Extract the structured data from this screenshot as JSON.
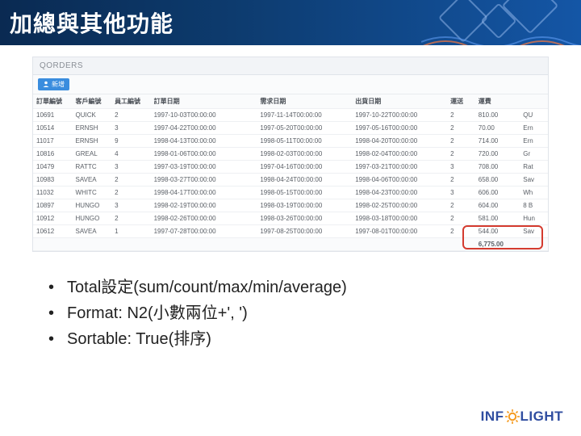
{
  "header": {
    "title": "加總與其他功能"
  },
  "panel": {
    "title": "QORDERS",
    "button_label": "新增"
  },
  "columns": [
    "訂單編號",
    "客戶編號",
    "員工編號",
    "訂單日期",
    "",
    "需求日期",
    "出貨日期",
    "運送",
    "運費",
    ""
  ],
  "rows": [
    {
      "c0": "10691",
      "c1": "QUICK",
      "c2": "2",
      "c3": "1997-10-03T00:00:00",
      "c4": "",
      "c5": "1997-11-14T00:00:00",
      "c6": "1997-10-22T00:00:00",
      "c7": "2",
      "c8": "810.00",
      "c9": "QU"
    },
    {
      "c0": "10514",
      "c1": "ERNSH",
      "c2": "3",
      "c3": "1997-04-22T00:00:00",
      "c4": "",
      "c5": "1997-05-20T00:00:00",
      "c6": "1997-05-16T00:00:00",
      "c7": "2",
      "c8": "70.00",
      "c9": "Ern"
    },
    {
      "c0": "11017",
      "c1": "ERNSH",
      "c2": "9",
      "c3": "1998-04-13T00:00:00",
      "c4": "",
      "c5": "1998-05-11T00:00:00",
      "c6": "1998-04-20T00:00:00",
      "c7": "2",
      "c8": "714.00",
      "c9": "Ern"
    },
    {
      "c0": "10816",
      "c1": "GREAL",
      "c2": "4",
      "c3": "1998-01-06T00:00:00",
      "c4": "",
      "c5": "1998-02-03T00:00:00",
      "c6": "1998-02-04T00:00:00",
      "c7": "2",
      "c8": "720.00",
      "c9": "Gr"
    },
    {
      "c0": "10479",
      "c1": "RATTC",
      "c2": "3",
      "c3": "1997-03-19T00:00:00",
      "c4": "",
      "c5": "1997-04-16T00:00:00",
      "c6": "1997-03-21T00:00:00",
      "c7": "3",
      "c8": "708.00",
      "c9": "Rat"
    },
    {
      "c0": "10983",
      "c1": "SAVEA",
      "c2": "2",
      "c3": "1998-03-27T00:00:00",
      "c4": "",
      "c5": "1998-04-24T00:00:00",
      "c6": "1998-04-06T00:00:00",
      "c7": "2",
      "c8": "658.00",
      "c9": "Sav"
    },
    {
      "c0": "11032",
      "c1": "WHITC",
      "c2": "2",
      "c3": "1998-04-17T00:00:00",
      "c4": "",
      "c5": "1998-05-15T00:00:00",
      "c6": "1998-04-23T00:00:00",
      "c7": "3",
      "c8": "606.00",
      "c9": "Wh"
    },
    {
      "c0": "10897",
      "c1": "HUNGO",
      "c2": "3",
      "c3": "1998-02-19T00:00:00",
      "c4": "",
      "c5": "1998-03-19T00:00:00",
      "c6": "1998-02-25T00:00:00",
      "c7": "2",
      "c8": "604.00",
      "c9": "8 B"
    },
    {
      "c0": "10912",
      "c1": "HUNGO",
      "c2": "2",
      "c3": "1998-02-26T00:00:00",
      "c4": "",
      "c5": "1998-03-26T00:00:00",
      "c6": "1998-03-18T00:00:00",
      "c7": "2",
      "c8": "581.00",
      "c9": "Hun"
    },
    {
      "c0": "10612",
      "c1": "SAVEA",
      "c2": "1",
      "c3": "1997-07-28T00:00:00",
      "c4": "",
      "c5": "1997-08-25T00:00:00",
      "c6": "1997-08-01T00:00:00",
      "c7": "2",
      "c8": "544.00",
      "c9": "Sav"
    }
  ],
  "total": "6,775.00",
  "bullets": [
    "Total設定(sum/count/max/min/average)",
    "Format: N2(小數兩位+', ')",
    "Sortable: True(排序)"
  ],
  "logo": {
    "part1": "INF",
    "part2": "LIGHT"
  }
}
